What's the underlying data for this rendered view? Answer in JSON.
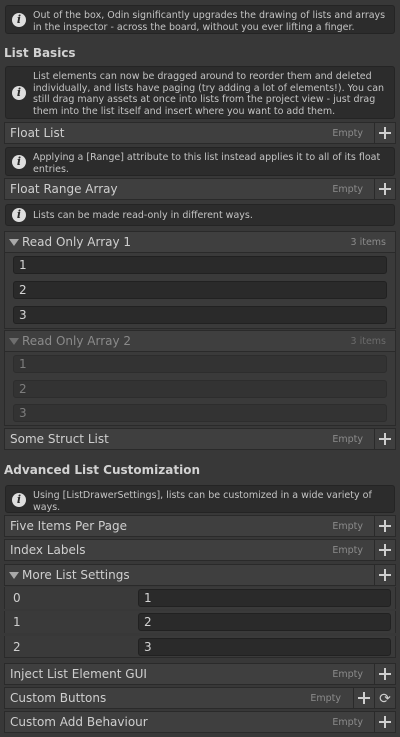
{
  "intro_info": "Out of the box, Odin significantly upgrades the drawing of lists and arrays in the inspector - across the board, without you ever lifting a finger.",
  "sections": {
    "list_basics": "List Basics",
    "advanced": "Advanced List Customization"
  },
  "list_basics_info": "List elements can now be dragged around to reorder them and deleted individually, and lists have paging (try adding a lot of elements!). You can still drag many assets at once into lists from the project view - just drag them into the list itself and insert where you want to add them.",
  "float_list": {
    "label": "Float List",
    "count": "Empty"
  },
  "range_info": "Applying a [Range] attribute to this list instead applies it to all of its float entries.",
  "float_range_array": {
    "label": "Float Range Array",
    "count": "Empty"
  },
  "readonly_info": "Lists can be made read-only in different ways.",
  "read_only_array_1": {
    "label": "Read Only Array 1",
    "count": "3 items",
    "values": [
      "1",
      "2",
      "3"
    ]
  },
  "read_only_array_2": {
    "label": "Read Only Array 2",
    "count": "3 items",
    "values": [
      "1",
      "2",
      "3"
    ]
  },
  "some_struct_list": {
    "label": "Some Struct List",
    "count": "Empty"
  },
  "advanced_info": "Using [ListDrawerSettings], lists can be customized in a wide variety of ways.",
  "five_items_per_page": {
    "label": "Five Items Per Page",
    "count": "Empty"
  },
  "index_labels": {
    "label": "Index Labels",
    "count": "Empty"
  },
  "more_list_settings": {
    "label": "More List Settings",
    "rows": [
      {
        "index": "0",
        "value": "1"
      },
      {
        "index": "1",
        "value": "2"
      },
      {
        "index": "2",
        "value": "3"
      }
    ]
  },
  "inject_list_element_gui": {
    "label": "Inject List Element GUI",
    "count": "Empty"
  },
  "custom_buttons": {
    "label": "Custom Buttons",
    "count": "Empty"
  },
  "custom_add_behaviour": {
    "label": "Custom Add Behaviour",
    "count": "Empty"
  },
  "icons": {
    "info": "info-icon",
    "add": "plus-icon",
    "refresh": "refresh-icon",
    "foldout": "foldout-triangle-icon"
  }
}
